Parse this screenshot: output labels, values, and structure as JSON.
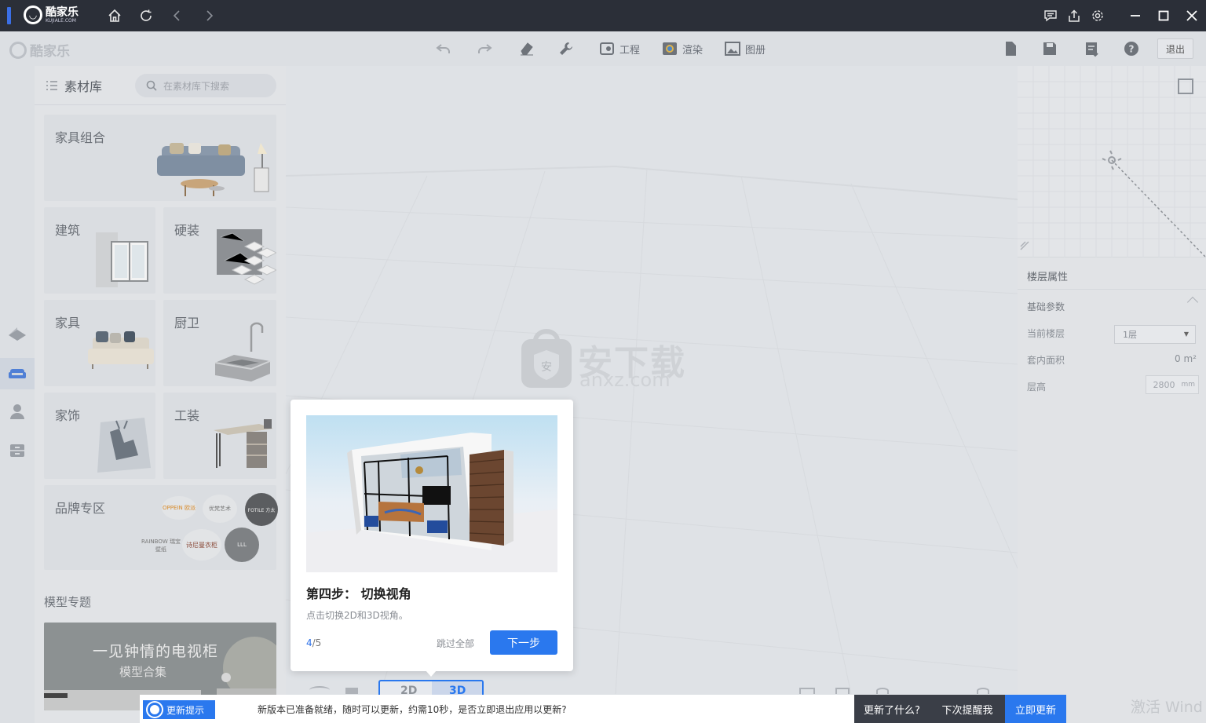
{
  "titlebar": {
    "logo_text": "酷家乐",
    "logo_sub": "KUJIALE.COM"
  },
  "toolbar": {
    "brand": "酷家乐",
    "engineering": "工程",
    "render": "渲染",
    "album": "图册",
    "exit": "退出"
  },
  "library": {
    "title": "素材库",
    "search_placeholder": "在素材库下搜索",
    "cards": {
      "furniture_set": "家具组合",
      "architecture": "建筑",
      "hard_decor": "硬装",
      "furniture": "家具",
      "kitchen_bath": "厨卫",
      "decor": "家饰",
      "tooling": "工装",
      "brand_zone": "品牌专区"
    },
    "brands": [
      "OPPEIN 欧派",
      "优梵艺术",
      "FOTILE 方太",
      "RAINBOW 瑞宝壁纸",
      "诗尼曼衣柜",
      "LLL"
    ],
    "section_title": "模型专题",
    "banner_title": "一见钟情的电视柜",
    "banner_sub": "模型合集"
  },
  "watermark": {
    "site": "安下载",
    "domain": "anxz.com"
  },
  "floor_props": {
    "title": "楼层属性",
    "basic_params": "基础参数",
    "current_floor_label": "当前楼层",
    "current_floor_value": "1层",
    "inner_area_label": "套内面积",
    "inner_area_value": "0 m²",
    "floor_height_label": "层高",
    "floor_height_value": "2800",
    "floor_height_unit": "mm"
  },
  "guide": {
    "title": "第四步： 切换视角",
    "desc": "点击切换2D和3D视角。",
    "step_current": "4",
    "step_total": "/5",
    "skip_all": "跳过全部",
    "next": "下一步"
  },
  "view_toggle": {
    "opt_2d": "2D",
    "opt_3d": "3D"
  },
  "update_bar": {
    "badge": "更新提示",
    "message": "新版本已准备就绪，随时可以更新，约需10秒，是否立即退出应用以更新?",
    "whats_new": "更新了什么?",
    "remind_later": "下次提醒我",
    "update_now": "立即更新"
  },
  "activate_text": "激活 Wind",
  "colors": {
    "accent": "#2a78ee",
    "titlebar": "#2b2f38"
  }
}
